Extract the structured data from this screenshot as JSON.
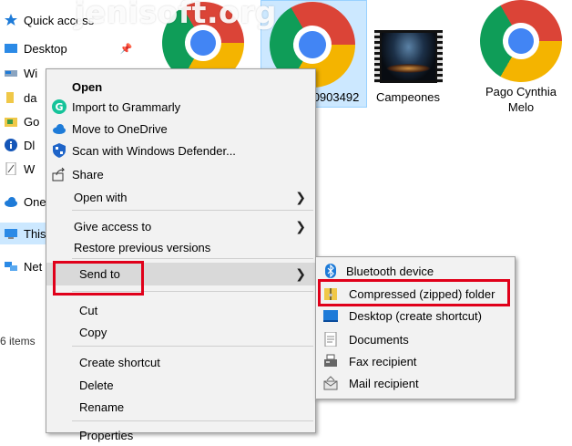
{
  "watermark": "jenisoft.org",
  "sidebar": {
    "items": [
      {
        "label": "Quick access",
        "icon": "star-icon"
      },
      {
        "label": "Desktop",
        "icon": "desktop-folder-icon"
      },
      {
        "label": "Wi",
        "icon": "drive-icon"
      },
      {
        "label": "da",
        "icon": "folder-icon"
      },
      {
        "label": "Go",
        "icon": "folder-icon"
      },
      {
        "label": "Dl",
        "icon": "info-icon"
      },
      {
        "label": "W",
        "icon": "document-icon"
      },
      {
        "label": "One",
        "icon": "onedrive-icon"
      },
      {
        "label": "This",
        "icon": "pc-icon"
      },
      {
        "label": "Net",
        "icon": "network-icon"
      }
    ],
    "status": "6 items"
  },
  "files": [
    {
      "label": "",
      "icon": "chrome-icon"
    },
    {
      "label": "0903492",
      "icon": "chrome-icon"
    },
    {
      "label": "Campeones",
      "icon": "video-icon"
    },
    {
      "label_line1": "Pago Cynthia",
      "label_line2": "Melo",
      "icon": "chrome-icon"
    }
  ],
  "context_menu": {
    "items": [
      {
        "label": "Open",
        "bold": true
      },
      {
        "label": "Import to Grammarly",
        "icon": "grammarly-icon"
      },
      {
        "label": "Move to OneDrive",
        "icon": "onedrive-icon"
      },
      {
        "label": "Scan with Windows Defender...",
        "icon": "defender-icon"
      },
      {
        "label": "Share",
        "icon": "share-icon"
      },
      {
        "label": "Open with",
        "submenu": true
      },
      {
        "label": "Give access to",
        "submenu": true
      },
      {
        "label": "Restore previous versions"
      },
      {
        "label": "Send to",
        "submenu": true,
        "highlighted": true
      },
      {
        "label": "Cut"
      },
      {
        "label": "Copy"
      },
      {
        "label": "Create shortcut"
      },
      {
        "label": "Delete"
      },
      {
        "label": "Rename"
      },
      {
        "label": "Properties"
      }
    ]
  },
  "send_to_menu": {
    "items": [
      {
        "label": "Bluetooth device",
        "icon": "bluetooth-icon"
      },
      {
        "label": "Compressed (zipped) folder",
        "icon": "zip-folder-icon",
        "highlighted": true
      },
      {
        "label": "Desktop (create shortcut)",
        "icon": "desktop-icon"
      },
      {
        "label": "Documents",
        "icon": "documents-icon"
      },
      {
        "label": "Fax recipient",
        "icon": "fax-icon"
      },
      {
        "label": "Mail recipient",
        "icon": "mail-icon"
      }
    ]
  },
  "colors": {
    "highlight_box": "#e0001a",
    "selection": "#cce8ff",
    "menu_bg": "#f2f2f2",
    "chrome_red": "#db4437",
    "chrome_yellow": "#f4b400",
    "chrome_green": "#0f9d58",
    "chrome_blue": "#4285f4"
  }
}
